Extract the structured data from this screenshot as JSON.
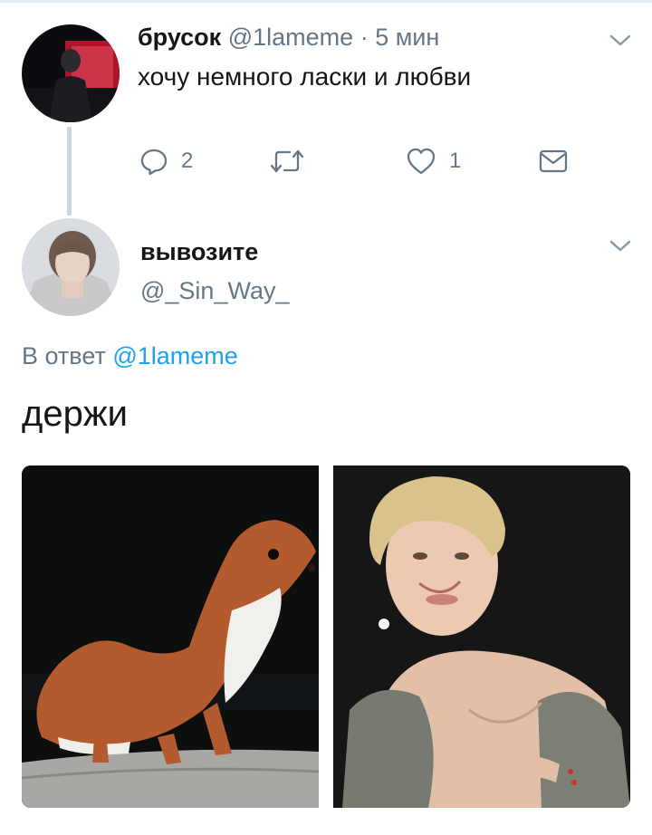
{
  "tweet1": {
    "display_name": "брусок",
    "handle": "@1lameme",
    "separator": "·",
    "time": "5 мин",
    "text": "хочу немного ласки и любви",
    "reply_count": "2",
    "like_count": "1",
    "icons": {
      "reply": "reply-icon",
      "retweet": "retweet-icon",
      "like": "heart-icon",
      "dm": "envelope-icon",
      "menu": "chevron-down-icon"
    }
  },
  "tweet2": {
    "display_name": "вывозите",
    "handle": "@_Sin_Way_",
    "reply_prefix": "В ответ",
    "reply_to": "@1lameme",
    "text": "держи",
    "images": [
      "ermine-photo",
      "woman-portrait-photo"
    ]
  },
  "colors": {
    "text": "#14171a",
    "secondary": "#657786",
    "link": "#1da1f2",
    "thread_line": "#ccd6dd"
  }
}
